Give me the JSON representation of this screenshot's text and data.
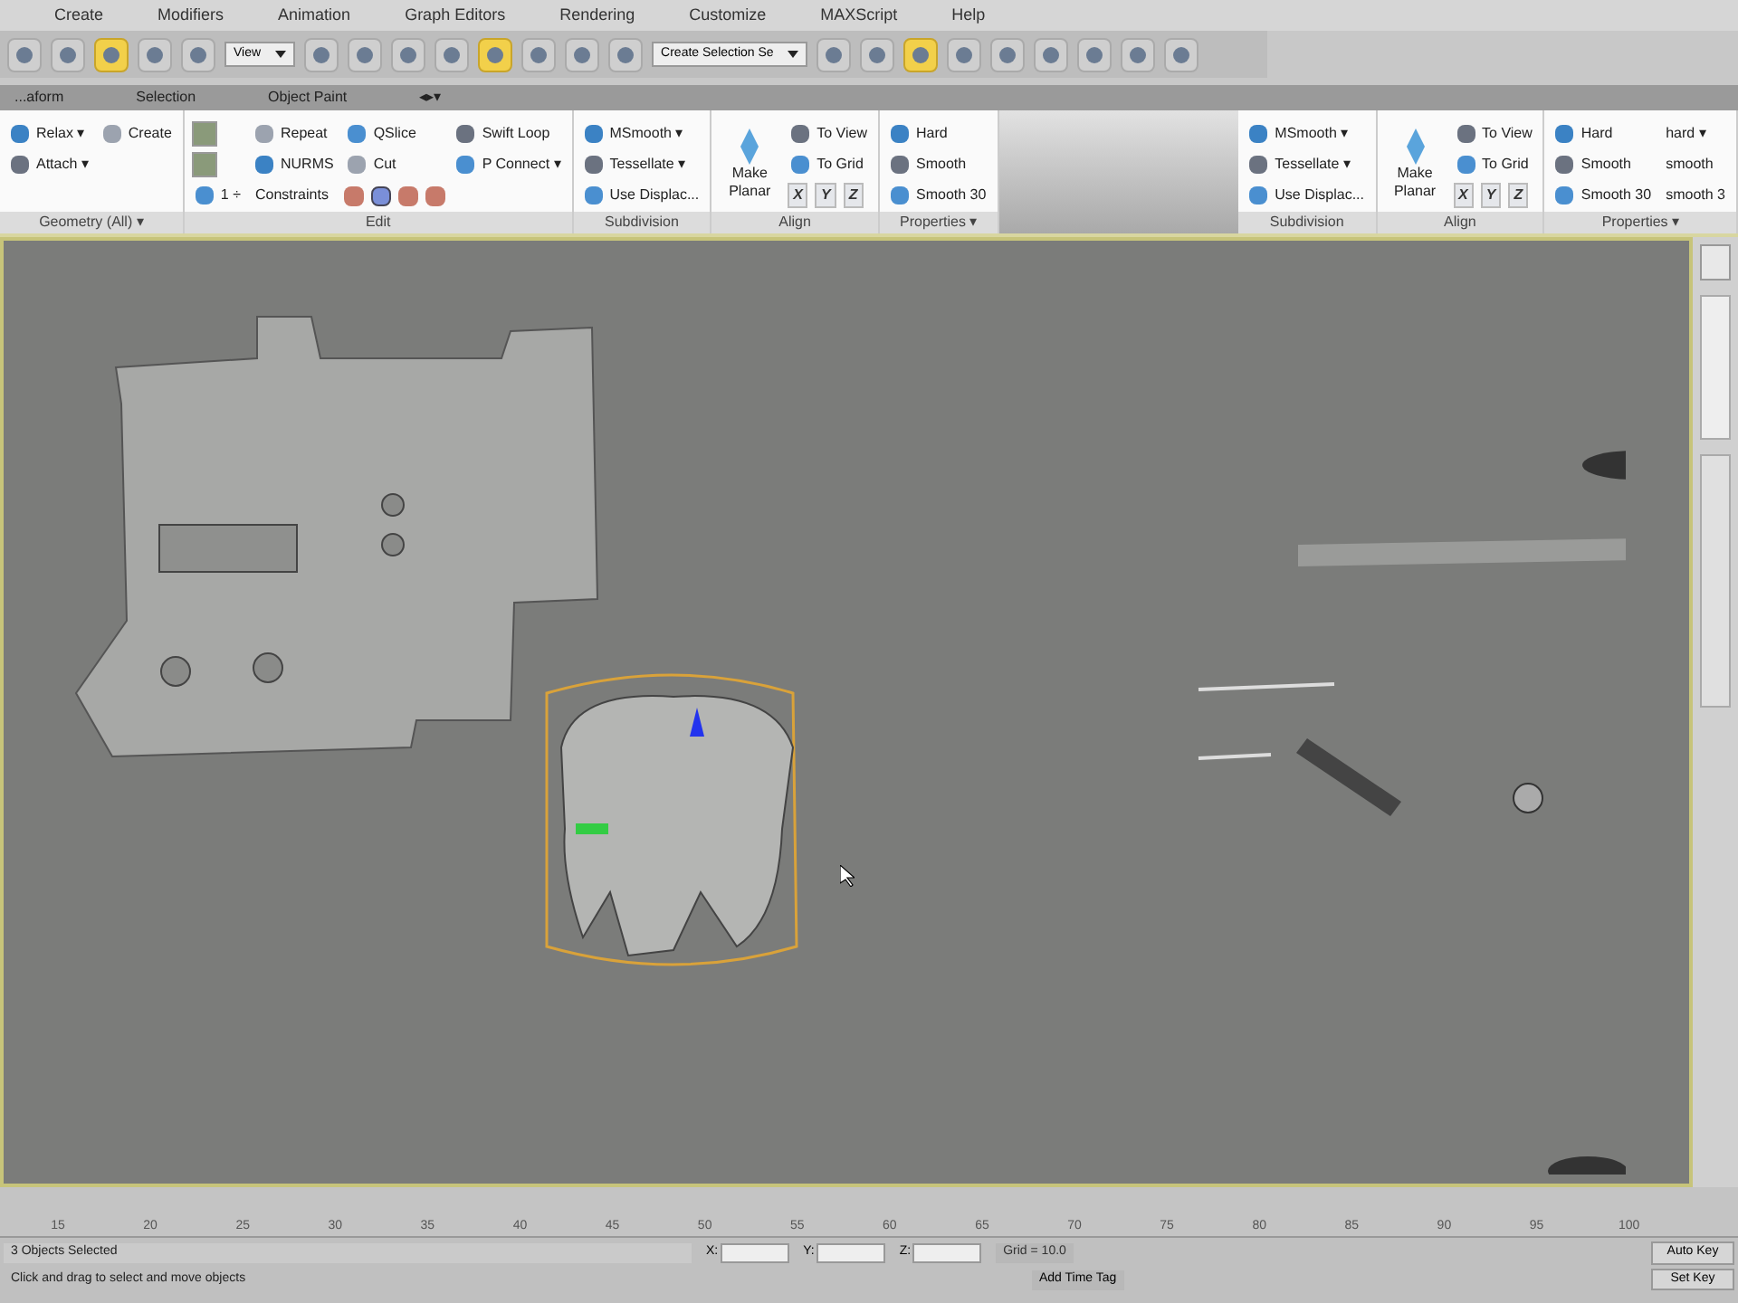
{
  "menu_bar": {
    "items": [
      "Create",
      "Modifiers",
      "Animation",
      "Graph Editors",
      "Rendering",
      "Customize",
      "MAXScript",
      "Help"
    ]
  },
  "toolbar": {
    "items": [
      {
        "kind": "button",
        "selected": false
      },
      {
        "kind": "button",
        "selected": false
      },
      {
        "kind": "button",
        "selected": true
      },
      {
        "kind": "button",
        "selected": false
      },
      {
        "kind": "button",
        "selected": false
      },
      {
        "kind": "dropdown",
        "value": "View"
      },
      {
        "kind": "button",
        "selected": false
      },
      {
        "kind": "button",
        "selected": false
      },
      {
        "kind": "button",
        "selected": false
      },
      {
        "kind": "button",
        "selected": false
      },
      {
        "kind": "button",
        "selected": true
      },
      {
        "kind": "button",
        "selected": false
      },
      {
        "kind": "button",
        "selected": false
      },
      {
        "kind": "button",
        "selected": false
      },
      {
        "kind": "dropdown",
        "value": "Create Selection Se"
      },
      {
        "kind": "button",
        "selected": false
      },
      {
        "kind": "button",
        "selected": false
      },
      {
        "kind": "button",
        "selected": true
      },
      {
        "kind": "button",
        "selected": false
      },
      {
        "kind": "button",
        "selected": false
      },
      {
        "kind": "button",
        "selected": false
      },
      {
        "kind": "button",
        "selected": false
      },
      {
        "kind": "button",
        "selected": false
      },
      {
        "kind": "button",
        "selected": false
      }
    ]
  },
  "ribbon_tabs": [
    {
      "label": "...aform",
      "selected": false
    },
    {
      "label": "Selection",
      "selected": false
    },
    {
      "label": "Object Paint",
      "selected": false
    },
    {
      "label": "◂▸▾",
      "selected": false
    }
  ],
  "ribbon_groups": [
    {
      "panels": [
        {
          "title": "Geometry (All) ▾",
          "items": [
            {
              "kind": "small",
              "label": "Relax ▾"
            },
            {
              "kind": "small",
              "label": "Attach ▾"
            },
            {
              "kind": "blank"
            },
            {
              "kind": "small",
              "label": "Create"
            }
          ]
        },
        {
          "title": "Edit",
          "items": [
            {
              "kind": "icon"
            },
            {
              "kind": "icon"
            },
            {
              "kind": "small",
              "label": "1 ÷"
            },
            {
              "kind": "small",
              "label": "Repeat"
            },
            {
              "kind": "small",
              "label": "NURMS"
            },
            {
              "kind": "label",
              "label": "Constraints"
            },
            {
              "kind": "small",
              "label": "QSlice"
            },
            {
              "kind": "small",
              "label": "Cut"
            },
            {
              "kind": "icons"
            },
            {
              "kind": "small",
              "label": "Swift Loop"
            },
            {
              "kind": "small",
              "label": "P Connect ▾"
            }
          ]
        },
        {
          "title": "Subdivision",
          "items": [
            {
              "kind": "small",
              "label": "MSmooth ▾"
            },
            {
              "kind": "small",
              "label": "Tessellate ▾"
            },
            {
              "kind": "small",
              "label": "Use Displac..."
            }
          ]
        },
        {
          "title": "Align",
          "items": [
            {
              "kind": "large",
              "label": "Make Planar"
            },
            {
              "kind": "small",
              "label": "To View"
            },
            {
              "kind": "small",
              "label": "To Grid"
            },
            {
              "kind": "axes",
              "labels": [
                "X",
                "Y",
                "Z"
              ]
            }
          ]
        },
        {
          "title": "Properties ▾",
          "items": [
            {
              "kind": "small",
              "label": "Hard"
            },
            {
              "kind": "small",
              "label": "Smooth"
            },
            {
              "kind": "small",
              "label": "Smooth 30"
            }
          ]
        }
      ]
    },
    {
      "panels": [
        {
          "title": "Subdivision",
          "items": [
            {
              "kind": "small",
              "label": "MSmooth ▾"
            },
            {
              "kind": "small",
              "label": "Tessellate ▾"
            },
            {
              "kind": "small",
              "label": "Use Displac..."
            }
          ]
        },
        {
          "title": "Align",
          "items": [
            {
              "kind": "large",
              "label": "Make Planar"
            },
            {
              "kind": "small",
              "label": "To View"
            },
            {
              "kind": "small",
              "label": "To Grid"
            },
            {
              "kind": "axes",
              "labels": [
                "X",
                "Y",
                "Z"
              ]
            }
          ]
        },
        {
          "title": "Properties ▾",
          "items": [
            {
              "kind": "small",
              "label": "Hard"
            },
            {
              "kind": "small",
              "label": "Smooth"
            },
            {
              "kind": "small",
              "label": "Smooth 30"
            },
            {
              "kind": "label",
              "label": "hard ▾"
            },
            {
              "kind": "label",
              "label": "smooth"
            },
            {
              "kind": "label",
              "label": "smooth 3"
            }
          ]
        }
      ]
    }
  ],
  "timeline": {
    "labels": [
      "15",
      "20",
      "25",
      "30",
      "35",
      "40",
      "45",
      "50",
      "55",
      "60",
      "65",
      "70",
      "75",
      "80",
      "85",
      "90",
      "95",
      "100"
    ]
  },
  "status_bar": {
    "selection": "3 Objects Selected",
    "prompt": "Click and drag to select and move objects",
    "fields": [
      {
        "label": "X:"
      },
      {
        "label": "Y:"
      },
      {
        "label": "Z:"
      }
    ],
    "grid": "Grid = 10.0",
    "time_tag": "Add Time Tag",
    "auto_key": "Auto Key",
    "set_key": "Set Key"
  }
}
